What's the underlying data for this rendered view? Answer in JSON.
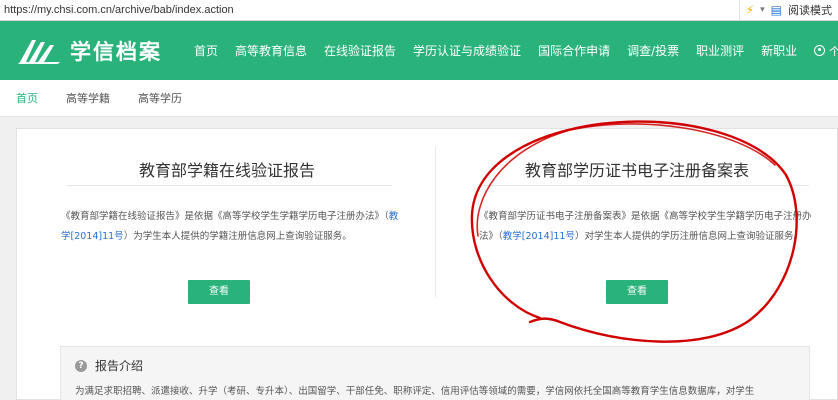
{
  "browser": {
    "url": "https://my.chsi.com.cn/archive/bab/index.action",
    "reader_mode_label": "阅读模式"
  },
  "header": {
    "logo_text": "学信档案",
    "nav": [
      "首页",
      "高等教育信息",
      "在线验证报告",
      "学历认证与成绩验证",
      "国际合作申请",
      "调查/投票",
      "职业测评",
      "新职业"
    ],
    "user_label": "个人中"
  },
  "breadcrumb": [
    "首页",
    "高等学籍",
    "高等学历"
  ],
  "cards": [
    {
      "title": "教育部学籍在线验证报告",
      "desc_before": "《教育部学籍在线验证报告》是依据《高等学校学生学籍学历电子注册办法》（",
      "desc_highlight": "教学[2014]11号",
      "desc_after": "）为学生本人提供的学籍注册信息网上查询验证服务。",
      "button": "查看"
    },
    {
      "title": "教育部学历证书电子注册备案表",
      "desc_before": "《教育部学历证书电子注册备案表》是依据《高等学校学生学籍学历电子注册办法》（",
      "desc_highlight": "教学[2014]11号",
      "desc_after": "）对学生本人提供的学历注册信息网上查询验证服务。",
      "button": "查看"
    }
  ],
  "intro": {
    "title": "报告介绍",
    "text": "为满足求职招聘、派遣接收、升学（考研、专升本）、出国留学、干部任免、职称评定、信用评估等领域的需要，学信网依托全国高等教育学生信息数据库，对学生"
  },
  "colors": {
    "brand_green": "#2ab27b",
    "link_blue": "#2a6fd6",
    "annotation_red": "#d10000"
  }
}
